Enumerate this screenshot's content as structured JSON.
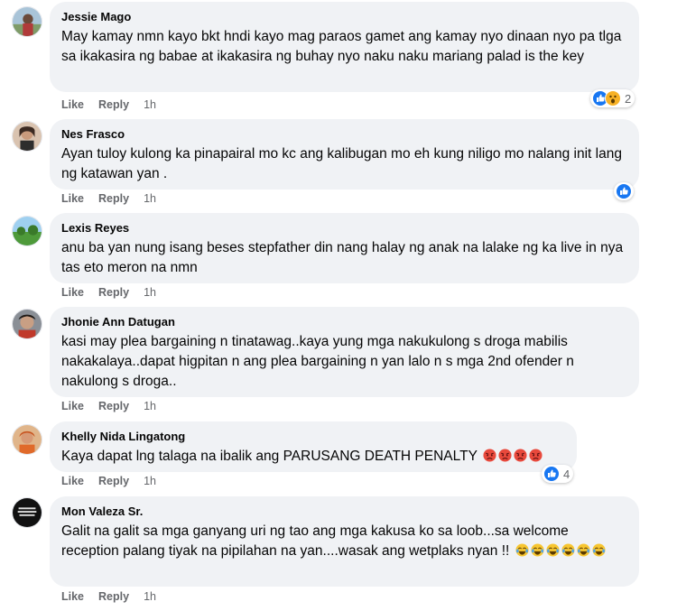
{
  "comments": [
    {
      "name": "Jessie Mago",
      "text": "May kamay nmn kayo bkt hndi kayo mag paraos gamet ang kamay nyo dinaan nyo pa tlga sa ikakasira ng babae at ikakasira ng buhay nyo naku naku mariang palad is the key",
      "like": "Like",
      "reply": "Reply",
      "time": "1h",
      "reactions": [
        "like-icon",
        "wow-icon"
      ],
      "reaction_count": "2"
    },
    {
      "name": "Nes Frasco",
      "text": "Ayan tuloy kulong ka pinapairal mo kc ang kalibugan mo eh kung niligo mo nalang init lang ng katawan yan .",
      "like": "Like",
      "reply": "Reply",
      "time": "1h",
      "reactions": [
        "like-icon"
      ],
      "reaction_count": ""
    },
    {
      "name": "Lexis Reyes",
      "text": "anu ba yan nung isang beses stepfather din nang halay ng anak na lalake ng ka live in nya tas eto meron na nmn",
      "like": "Like",
      "reply": "Reply",
      "time": "1h"
    },
    {
      "name": "Jhonie Ann Datugan",
      "text": "kasi may plea bargaining n tinatawag..kaya yung mga nakukulong s droga mabilis nakakalaya..dapat higpitan n ang plea bargaining n yan lalo n s mga 2nd ofender n nakulong s droga..",
      "like": "Like",
      "reply": "Reply",
      "time": "1h"
    },
    {
      "name": "Khelly Nida Lingatong",
      "text": "Kaya dapat lng talaga na ibalik ang PARUSANG DEATH PENALTY",
      "emojis": [
        "angry-emoji",
        "angry-emoji",
        "angry-emoji",
        "angry-emoji"
      ],
      "like": "Like",
      "reply": "Reply",
      "time": "1h",
      "reactions": [
        "like-icon"
      ],
      "reaction_count": "4"
    },
    {
      "name": "Mon Valeza Sr.",
      "text": "Galit na galit sa mga ganyang uri ng tao ang mga kakusa ko sa loob...sa welcome reception palang tiyak na pipilahan na yan....wasak ang wetplaks nyan !!",
      "emojis": [
        "tears-of-joy-emoji",
        "tears-of-joy-emoji",
        "tears-of-joy-emoji",
        "tears-of-joy-emoji",
        "tears-of-joy-emoji",
        "tears-of-joy-emoji"
      ],
      "like": "Like",
      "reply": "Reply",
      "time": "1h"
    }
  ],
  "colors": {
    "bubble": "#f0f2f5",
    "meta": "#65676b",
    "like_blue": "#1877f2",
    "wow_yellow": "#f7b125"
  }
}
